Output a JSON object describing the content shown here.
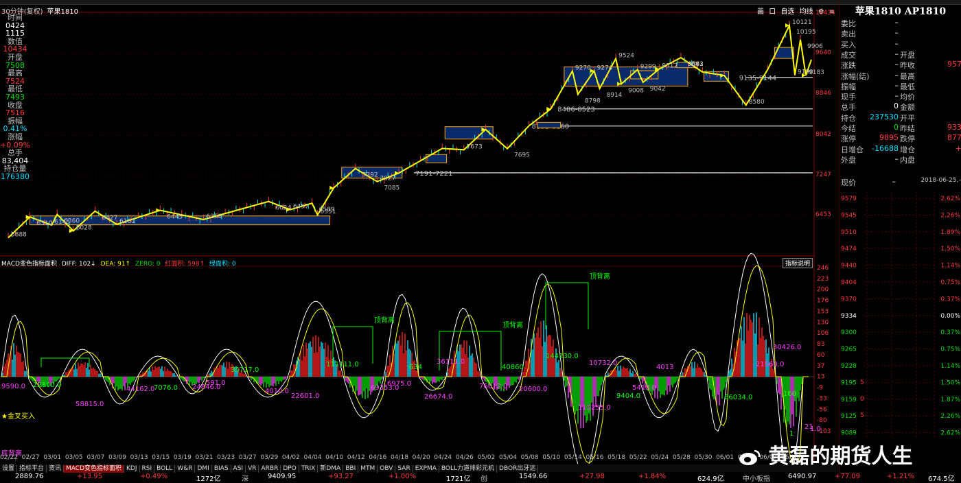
{
  "window": {
    "title_period": "30分钟(复权)",
    "title_symbol": "苹果1810"
  },
  "toolbar": {
    "items": [
      "画",
      "口",
      "自选",
      "均线",
      "⚙",
      "≡"
    ]
  },
  "left_info": [
    {
      "label": "时间",
      "value": "0424",
      "vcolor": "white"
    },
    {
      "label": "",
      "value": "1115",
      "vcolor": "white"
    },
    {
      "label": "数值",
      "value": "10434",
      "vcolor": "red"
    },
    {
      "label": "开盘",
      "value": "7508",
      "vcolor": "green"
    },
    {
      "label": "最高",
      "value": "7524",
      "vcolor": "red"
    },
    {
      "label": "最低",
      "value": "7493",
      "vcolor": "green"
    },
    {
      "label": "收盘",
      "value": "7516",
      "vcolor": "red"
    },
    {
      "label": "振幅",
      "value": "0.41%",
      "vcolor": "cyan"
    },
    {
      "label": "涨幅",
      "value": "+0.09%",
      "vcolor": "red"
    },
    {
      "label": "总手",
      "value": "83,404",
      "vcolor": "white"
    },
    {
      "label": "持仓量",
      "value": "176380",
      "vcolor": "cyan"
    }
  ],
  "price_axis": [
    "10434",
    "9640",
    "8846",
    "8042",
    "7247",
    "6453"
  ],
  "panel": {
    "title": "苹果1810 AP1810",
    "rows": [
      {
        "k": "委比",
        "v": "–",
        "vc": "white",
        "k2": "",
        "v2": ""
      },
      {
        "k": "卖出",
        "v": "–",
        "vc": "white",
        "k2": "",
        "v2": ""
      },
      {
        "k": "买入",
        "v": "–",
        "vc": "white",
        "k2": "",
        "v2": ""
      },
      {
        "k": "成交",
        "v": "–",
        "vc": "white",
        "k2": "开盘",
        "v2": ""
      },
      {
        "k": "涨跌",
        "v": "–",
        "vc": "white",
        "k2": "昨收",
        "v2": "957"
      },
      {
        "k": "涨幅(结)",
        "v": "–",
        "vc": "white",
        "k2": "最高",
        "v2": ""
      },
      {
        "k": "振幅",
        "v": "–",
        "vc": "white",
        "k2": "最低",
        "v2": ""
      },
      {
        "k": "现手",
        "v": "–",
        "vc": "white",
        "k2": "均价",
        "v2": ""
      },
      {
        "k": "总手",
        "v": "0",
        "vc": "white",
        "k2": "金额",
        "v2": ""
      },
      {
        "k": "持仓",
        "v": "237530",
        "vc": "cyan",
        "k2": "开平",
        "v2": ""
      },
      {
        "k": "今结",
        "v": "0",
        "vc": "green",
        "k2": "昨结",
        "v2": "933"
      },
      {
        "k": "涨停",
        "v": "9895",
        "vc": "red",
        "k2": "跌停",
        "v2": "877"
      },
      {
        "k": "日增仓",
        "v": "-16688",
        "vc": "cyan",
        "k2": "增仓",
        "v2": "+"
      },
      {
        "k": "外盘",
        "v": "–",
        "vc": "white",
        "k2": "内盘",
        "v2": ""
      }
    ],
    "price_label": "现价",
    "price_value": "–",
    "date": "2018-06-25,–",
    "ladder_prices": [
      "9579",
      "9545",
      "9510",
      "9474",
      "9440",
      "9404",
      "9370",
      "9334",
      "9300",
      "9265",
      "9228",
      "9195",
      "9159",
      "9125",
      "9089"
    ],
    "ladder_pcts": [
      "2.62%",
      "2.26%",
      "1.89%",
      "1.50%",
      "1.14%",
      "0.75%",
      "0.37%",
      "0.00%",
      "0.37%",
      "0.75%",
      "1.14%",
      "1.50%",
      "1.87%",
      "2.26%",
      "2.62%"
    ],
    "vol_axis": [
      "5",
      "0",
      "5"
    ]
  },
  "macd": {
    "name": "MACD变色指标面积",
    "diff": "DIFF: 102↓",
    "dea": "DEA: 91↑",
    "zero": "ZERO: 0",
    "red_area": "红面积: 598↑",
    "green_area": "绿面积: 0",
    "help": "指标说明",
    "axis": [
      "246",
      "223",
      "200",
      "176",
      "153",
      "130",
      "106",
      "83",
      "60",
      "37",
      "13",
      "-9",
      "-33",
      "-56",
      "-80",
      "-103"
    ],
    "labels_top_divergence": "顶背离",
    "labels_bottom_divergence": "底背离",
    "golden_cross": "★金叉买入"
  },
  "xaxis": [
    "02/22",
    "02/27",
    "03/01",
    "03/05",
    "03/07",
    "03/09",
    "03/13",
    "03/15",
    "03/19",
    "03/21",
    "03/23",
    "03/27",
    "03/29",
    "04/02",
    "04/04",
    "04/10",
    "04/12",
    "04/16",
    "04/18",
    "04/20",
    "04/24",
    "04/26",
    "05/02",
    "05/04",
    "05/08",
    "05/10",
    "05/14",
    "05/16",
    "05/18",
    "05/22",
    "05/24",
    "05/28",
    "05/30",
    "06/01",
    "06/05",
    "06/07",
    "06/11"
  ],
  "tabs": [
    "设置",
    "指标平台",
    "资讯",
    "MACD变色指标面积",
    "KDJ",
    "RSI",
    "BOLL",
    "W&R",
    "DMI",
    "BIAS",
    "ASI",
    "VR",
    "ARBR",
    "DPO",
    "TRIX",
    "新DMA",
    "BBI",
    "MTM",
    "OBV",
    "SAR",
    "EXPMA",
    "BOLL力道排彩元机",
    "DBOR出牙远"
  ],
  "status": [
    "2889.76",
    "+13.95",
    "+0.49%",
    "1272亿",
    "深",
    "9409.95",
    "+93.27",
    "+1.00%",
    "1721亿",
    "创",
    "1549.66",
    "+27.98",
    "+1.84%",
    "624.9亿",
    "中小板指",
    "6490.97",
    "+77.09",
    "+1.21%",
    "674.5亿"
  ],
  "watermark": "黄磊的期货人生",
  "chart_data": {
    "type": "line",
    "symbol": "苹果1810",
    "period": "30分钟",
    "ylim": [
      5700,
      10434
    ],
    "price_path": [
      {
        "x": "02/22",
        "y": 5888
      },
      {
        "x": "02/27",
        "y": 6310
      },
      {
        "x": "03/01",
        "y": 6145
      },
      {
        "x": "03/01",
        "y": 6360
      },
      {
        "x": "03/05",
        "y": 6028
      },
      {
        "x": "03/07",
        "y": 6427
      },
      {
        "x": "03/09",
        "y": 6161
      },
      {
        "x": "03/15",
        "y": 6445
      },
      {
        "x": "03/21",
        "y": 6258
      },
      {
        "x": "03/29",
        "y": 6624
      },
      {
        "x": "04/02",
        "y": 6457
      },
      {
        "x": "04/04",
        "y": 6589
      },
      {
        "x": "04/04",
        "y": 6351
      },
      {
        "x": "04/10",
        "y": 6900
      },
      {
        "x": "04/12",
        "y": 7292
      },
      {
        "x": "04/16",
        "y": 7027
      },
      {
        "x": "04/18",
        "y": 7200
      },
      {
        "x": "04/24",
        "y": 7700
      },
      {
        "x": "04/26",
        "y": 7673
      },
      {
        "x": "05/02",
        "y": 8085
      },
      {
        "x": "05/04",
        "y": 7695
      },
      {
        "x": "05/08",
        "y": 8160
      },
      {
        "x": "05/10",
        "y": 8500
      },
      {
        "x": "05/14",
        "y": 9270
      },
      {
        "x": "05/14",
        "y": 8798
      },
      {
        "x": "05/16",
        "y": 9274
      },
      {
        "x": "05/16",
        "y": 8914
      },
      {
        "x": "05/18",
        "y": 9524
      },
      {
        "x": "05/18",
        "y": 9008
      },
      {
        "x": "05/22",
        "y": 9299
      },
      {
        "x": "05/22",
        "y": 9042
      },
      {
        "x": "05/24",
        "y": 9312
      },
      {
        "x": "05/28",
        "y": 9543
      },
      {
        "x": "05/30",
        "y": 9250
      },
      {
        "x": "06/01",
        "y": 9180
      },
      {
        "x": "06/05",
        "y": 8580
      },
      {
        "x": "06/07",
        "y": 9300
      },
      {
        "x": "06/11",
        "y": 10195
      },
      {
        "x": "06/11",
        "y": 9190
      },
      {
        "x": "06/11",
        "y": 9906
      },
      {
        "x": "06/11",
        "y": 9183
      },
      {
        "x": "06/11",
        "y": 9502
      }
    ],
    "price_labels": [
      "5888",
      "6310",
      "6145",
      "6360",
      "6028",
      "6427",
      "6161",
      "6445",
      "6258",
      "6624",
      "6457",
      "6589",
      "6351",
      "7292",
      "7027",
      "7085",
      "7673",
      "7695",
      "9270",
      "8798",
      "9274",
      "8914",
      "9524",
      "9008",
      "9299",
      "9042",
      "9312",
      "9543",
      "8580",
      "10195",
      "10121",
      "9906",
      "9190",
      "9602",
      "9183"
    ],
    "zones": [
      {
        "label": "",
        "low": 6150,
        "high": 6330
      },
      {
        "label": "7191-7221",
        "low": 7191,
        "high": 7221
      },
      {
        "label": "8152-8160",
        "low": 8152,
        "high": 8160
      },
      {
        "label": "8486-8523",
        "low": 8486,
        "high": 8523
      },
      {
        "label": "9135-9144",
        "low": 9135,
        "high": 9144
      }
    ],
    "macd_labels": [
      "9590.0",
      "22800.0",
      "58815.0",
      "44162.0",
      "7076.0",
      "24846.0",
      "591.0",
      "35717.0",
      "4010.0",
      "22601.0",
      "111111.0",
      "6975.0",
      "69353.0",
      "634",
      "26674.0",
      "36111.0",
      "40860",
      "76612.0",
      "20600.0",
      "144230.0",
      "110255.0",
      "10732.0",
      "9404.0",
      "5418.0",
      "4013",
      "66034.0",
      "21560.0",
      "30426.0",
      "160",
      "21",
      "1.0",
      "1"
    ]
  }
}
